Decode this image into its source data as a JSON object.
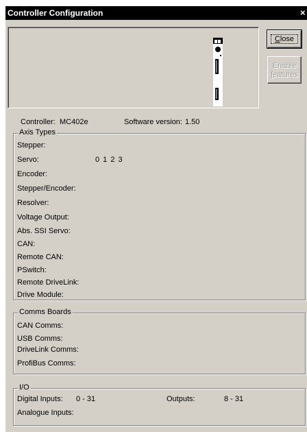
{
  "window": {
    "title": "Controller Configuration",
    "close_glyph": "×"
  },
  "buttons": {
    "close": {
      "prefix": "",
      "mnemonic": "C",
      "rest": "lose"
    },
    "enable_features": {
      "line1": "Enable",
      "line2_mnemonic": "f",
      "line2_rest": "eatures"
    }
  },
  "info": {
    "controller_label": "Controller:",
    "controller_value": "MC402e",
    "software_label": "Software version:",
    "software_value": "1.50"
  },
  "axis_types": {
    "legend": "Axis Types",
    "rows": [
      {
        "label": "Stepper:",
        "value": ""
      },
      {
        "label": "Servo:",
        "value": "0 1 2 3"
      },
      {
        "label": "Encoder:",
        "value": ""
      },
      {
        "label": "Stepper/Encoder:",
        "value": ""
      },
      {
        "label": "Resolver:",
        "value": ""
      },
      {
        "label": "Voltage Output:",
        "value": ""
      },
      {
        "label": "Abs. SSI Servo:",
        "value": ""
      },
      {
        "label": "CAN:",
        "value": ""
      },
      {
        "label": "Remote CAN:",
        "value": ""
      },
      {
        "label": "PSwitch:",
        "value": ""
      },
      {
        "label": "Remote DriveLink:",
        "value": ""
      },
      {
        "label": "Drive Module:",
        "value": ""
      }
    ]
  },
  "comms_boards": {
    "legend": "Comms Boards",
    "rows": [
      {
        "label": "CAN Comms:"
      },
      {
        "label": "USB Comms:"
      },
      {
        "label": "DriveLink Comms:"
      },
      {
        "label": "ProfiBus Comms:"
      }
    ]
  },
  "io": {
    "legend": "I/O",
    "digital_inputs_label": "Digital Inputs:",
    "digital_inputs_value": "0 - 31",
    "outputs_label": "Outputs:",
    "outputs_value": "8 - 31",
    "analogue_inputs_label": "Analogue Inputs:"
  }
}
